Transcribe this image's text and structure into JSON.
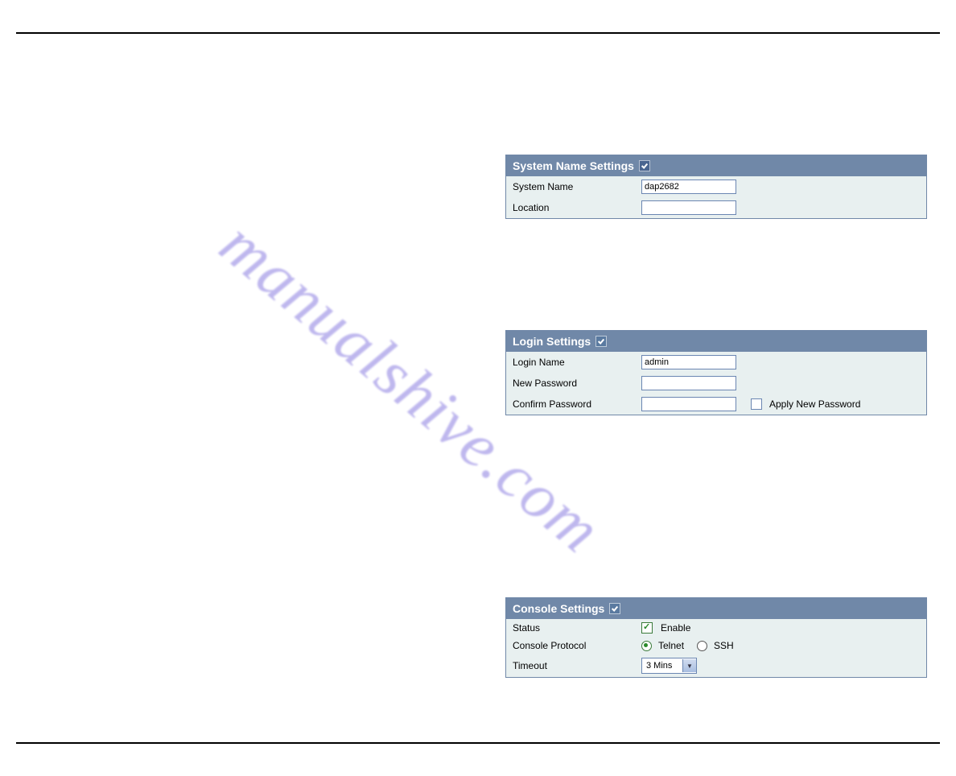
{
  "watermark_text": "manualshive.com",
  "panels": {
    "system_name": {
      "title": "System Name Settings",
      "rows": {
        "system_name_label": "System Name",
        "system_name_value": "dap2682",
        "location_label": "Location",
        "location_value": ""
      }
    },
    "login": {
      "title": "Login Settings",
      "rows": {
        "login_name_label": "Login Name",
        "login_name_value": "admin",
        "new_password_label": "New Password",
        "confirm_password_label": "Confirm Password",
        "apply_new_password_label": "Apply New Password"
      }
    },
    "console": {
      "title": "Console Settings",
      "rows": {
        "status_label": "Status",
        "status_enable_label": "Enable",
        "console_protocol_label": "Console Protocol",
        "protocol_telnet": "Telnet",
        "protocol_ssh": "SSH",
        "timeout_label": "Timeout",
        "timeout_value": "3 Mins"
      }
    }
  }
}
